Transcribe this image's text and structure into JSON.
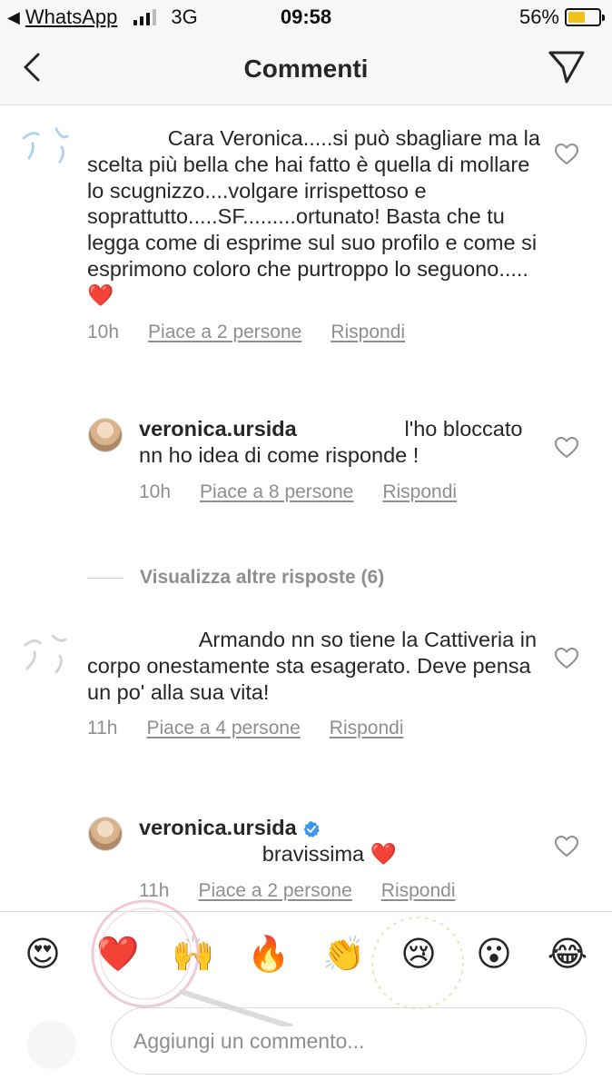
{
  "status_bar": {
    "back_app": "WhatsApp",
    "network": "3G",
    "time": "09:58",
    "battery_percent": "56%",
    "battery_level": 0.56
  },
  "nav": {
    "title": "Commenti"
  },
  "comments": [
    {
      "username_obscured": "       ",
      "text": "Cara Veronica.....si può sbagliare ma la scelta più bella che hai fatto è quella di mollare lo scugnizzo....volgare irrispettoso e soprattutto.....SF.........ortunato! Basta che tu legga come di esprime sul suo profilo e come si esprimono coloro che purtroppo lo seguono..... ❤️",
      "time": "10h",
      "likes": "Piace a 2 persone",
      "reply": "Rispondi"
    },
    {
      "username": "veronica.ursida",
      "text": "l'ho bloccato nn ho idea di come risponde !",
      "time": "10h",
      "likes": "Piace a 8 persone",
      "reply": "Rispondi"
    },
    {
      "view_more": "Visualizza altre risposte (6)"
    },
    {
      "text": "Armando nn so tiene la Cattiveria in corpo onestamente sta esagerato. Deve pensa un po' alla sua vita!",
      "time": "11h",
      "likes": "Piace a 4 persone",
      "reply": "Rispondi"
    },
    {
      "username": "veronica.ursida",
      "text": "bravissima ❤️",
      "time": "11h",
      "likes": "Piace a 2 persone",
      "reply": "Rispondi"
    }
  ],
  "emoji_bar": [
    "😍",
    "❤️",
    "🙌",
    "🔥",
    "👏",
    "😢",
    "😮",
    "😂"
  ],
  "input": {
    "placeholder": "Aggiungi un commento..."
  },
  "icons": {
    "back": "chevron-left-icon",
    "send": "direct-send-icon",
    "like": "heart-outline-icon",
    "verified": "verified-badge-icon"
  },
  "colors": {
    "verified_blue": "#3897f0",
    "battery_yellow": "#f2c21b",
    "meta_gray": "#8e8e8e"
  }
}
